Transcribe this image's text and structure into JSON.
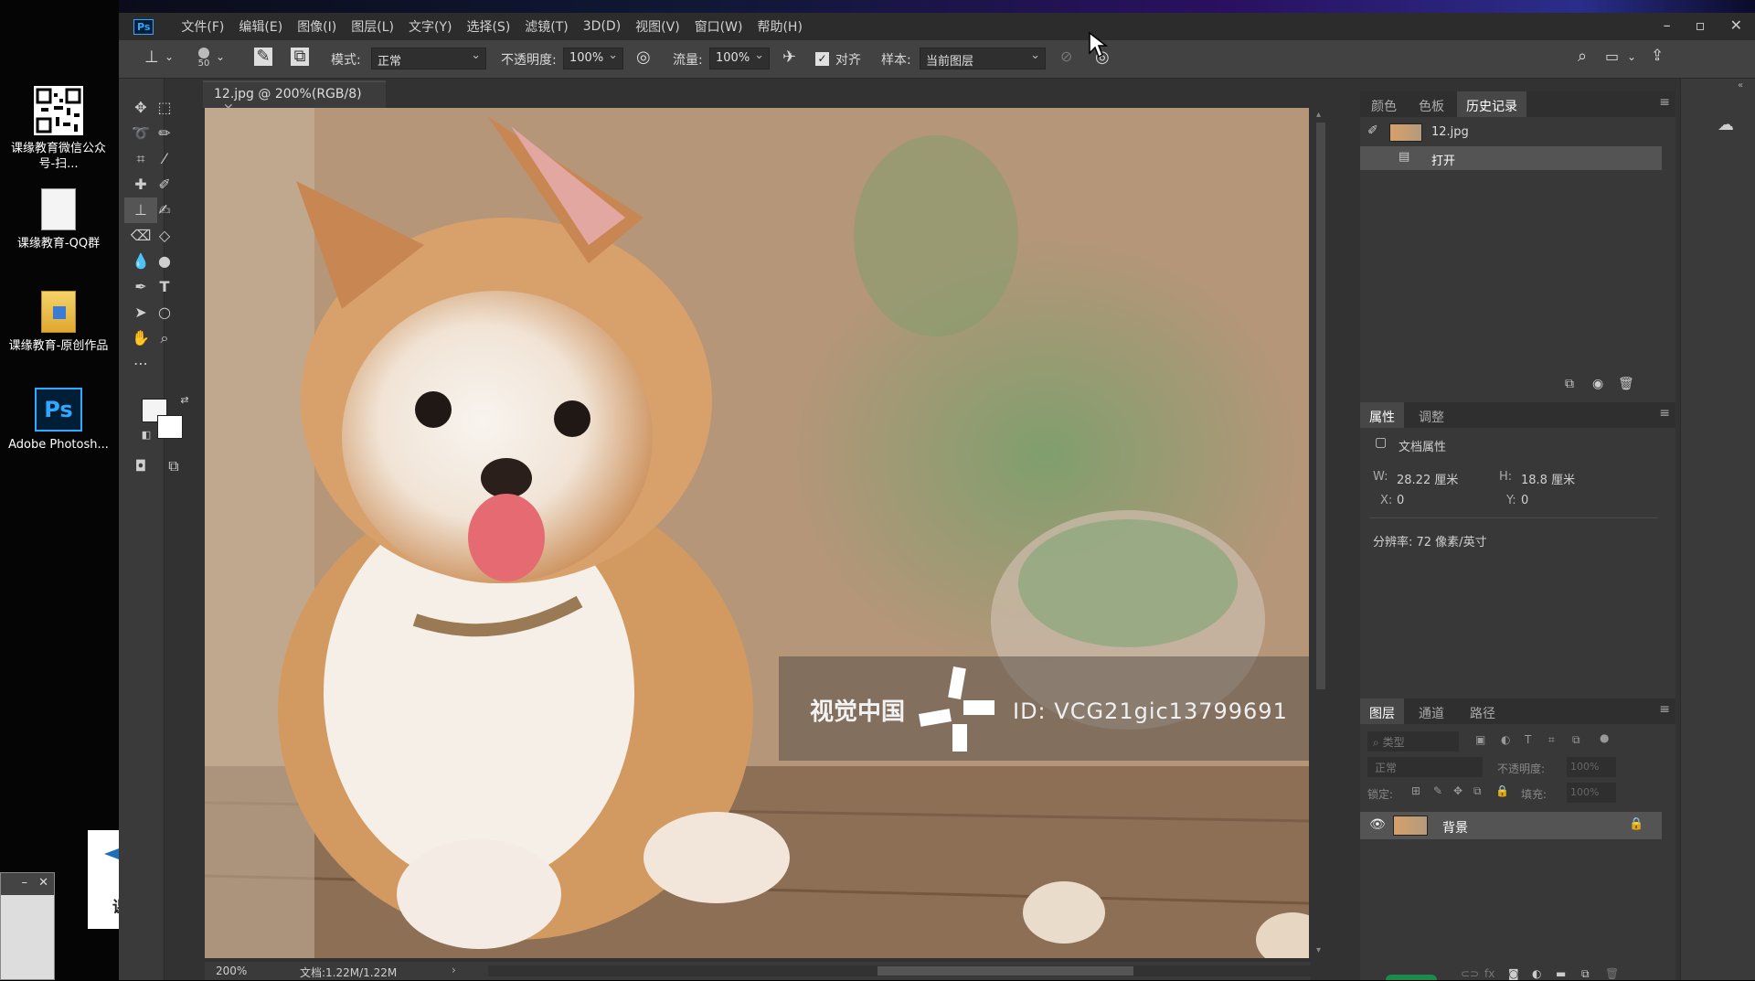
{
  "desktop": {
    "icons": [
      {
        "label": "课缘教育微信公众号-扫..."
      },
      {
        "label": "课缘教育-QQ群"
      },
      {
        "label": "课缘教育-原创作品"
      },
      {
        "label": "Adobe Photosh..."
      }
    ],
    "promo_logo_text": "课缘教育",
    "ps_badge": "Ps"
  },
  "menu": {
    "app_icon": "Ps",
    "items": [
      "文件(F)",
      "编辑(E)",
      "图像(I)",
      "图层(L)",
      "文字(Y)",
      "选择(S)",
      "滤镜(T)",
      "3D(D)",
      "视图(V)",
      "窗口(W)",
      "帮助(H)"
    ]
  },
  "options": {
    "brush_size": "50",
    "mode_label": "模式:",
    "mode_value": "正常",
    "opacity_label": "不透明度:",
    "opacity_value": "100%",
    "flow_label": "流量:",
    "flow_value": "100%",
    "align_label": "对齐",
    "sample_label": "样本:",
    "sample_value": "当前图层"
  },
  "document": {
    "tab_title": "12.jpg @ 200%(RGB/8)",
    "watermark_brand": "视觉中国",
    "watermark_id": "ID: VCG21gic13799691",
    "zoom": "200%",
    "doc_size": "文档:1.22M/1.22M"
  },
  "history_panel": {
    "tabs": [
      "颜色",
      "色板",
      "历史记录"
    ],
    "snapshot": "12.jpg",
    "step": "打开"
  },
  "properties_panel": {
    "tabs": [
      "属性",
      "调整"
    ],
    "title": "文档属性",
    "w_label": "W:",
    "w_value": "28.22 厘米",
    "h_label": "H:",
    "h_value": "18.8 厘米",
    "x_label": "X:",
    "x_value": "0",
    "y_label": "Y:",
    "y_value": "0",
    "resolution": "分辨率: 72 像素/英寸"
  },
  "layers_panel": {
    "tabs": [
      "图层",
      "通道",
      "路径"
    ],
    "filter_placeholder": "类型",
    "blend_mode": "正常",
    "opacity_label": "不透明度:",
    "opacity_value": "100%",
    "lock_label": "锁定:",
    "fill_label": "填充:",
    "fill_value": "100%",
    "layer_name": "背景"
  },
  "colors": {
    "ps_blue": "#31a8ff",
    "ps_dark": "#001e36",
    "panel_bg": "#383838"
  }
}
